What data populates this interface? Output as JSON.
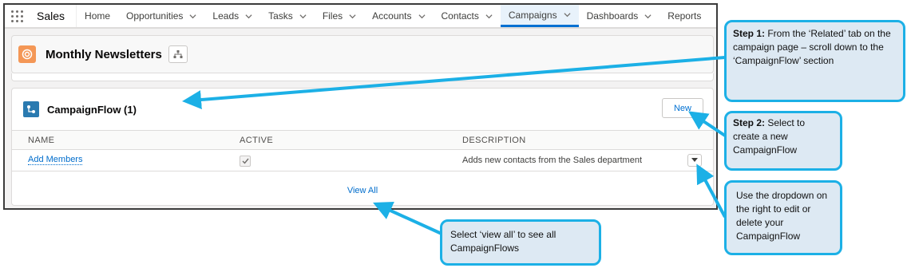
{
  "nav": {
    "app_name": "Sales",
    "items": [
      {
        "label": "Home",
        "has_menu": false,
        "active": false
      },
      {
        "label": "Opportunities",
        "has_menu": true,
        "active": false
      },
      {
        "label": "Leads",
        "has_menu": true,
        "active": false
      },
      {
        "label": "Tasks",
        "has_menu": true,
        "active": false
      },
      {
        "label": "Files",
        "has_menu": true,
        "active": false
      },
      {
        "label": "Accounts",
        "has_menu": true,
        "active": false
      },
      {
        "label": "Contacts",
        "has_menu": true,
        "active": false
      },
      {
        "label": "Campaigns",
        "has_menu": true,
        "active": true
      },
      {
        "label": "Dashboards",
        "has_menu": true,
        "active": false
      },
      {
        "label": "Reports",
        "has_menu": false,
        "active": false
      }
    ]
  },
  "record": {
    "title": "Monthly Newsletters",
    "icon": "campaign-icon",
    "accent_color": "#f49756"
  },
  "card": {
    "title": "CampaignFlow (1)",
    "new_label": "New",
    "columns": [
      "NAME",
      "ACTIVE",
      "DESCRIPTION"
    ],
    "rows": [
      {
        "name": "Add Members",
        "active": true,
        "description": "Adds new contacts from the Sales department"
      }
    ],
    "view_all": "View All"
  },
  "callouts": {
    "step1_bold": "Step 1:",
    "step1_text": " From the ‘Related’ tab on the campaign page – scroll down to the ‘CampaignFlow’ section",
    "step2_bold": "Step 2:",
    "step2_text": " Select to create a new CampaignFlow",
    "dropdown_text": "Use the dropdown on the right to edit or delete your CampaignFlow",
    "viewall_text": "Select ‘view all’ to see all CampaignFlows",
    "border_color": "#1cb0e6",
    "fill_color": "#dde9f3"
  }
}
